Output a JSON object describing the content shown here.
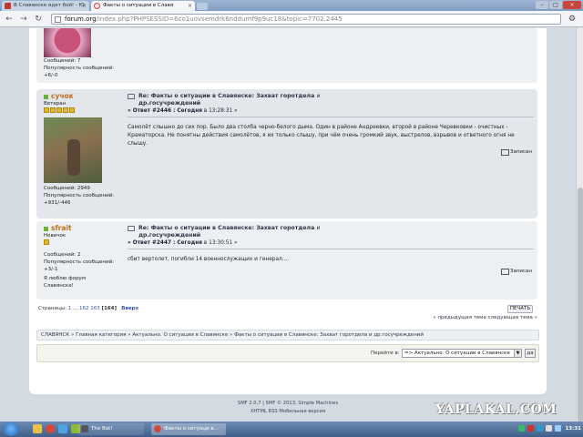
{
  "browser": {
    "tabs": [
      {
        "label": "В Славянске идет бой! - Ю"
      },
      {
        "label": "Факты о ситуации в Славя"
      }
    ],
    "url_host": "forum.org",
    "url_path": "/index.php?PHPSESSID=6co1uovsemdrk6nddumf9p9uc18&topic=7702.2445"
  },
  "posts": [
    {
      "messages": "Сообщений: 7",
      "popularity": "Популярность сообщений:",
      "popularity_value": "+6/-0"
    },
    {
      "name": "сучок",
      "rank": "Ветеран",
      "stars": 5,
      "title": "Re: Факты о ситуации в Славянске: Захват горотдела",
      "title_rest": "и",
      "title_line2": "др.госучреждений",
      "meta_reply": "« Ответ #2446 : Сегодня",
      "meta_at": "в",
      "meta_time": "13:28:31 »",
      "text": "Самолёт слышно до сих пор. Было два столба черно-белого дыма. Один в районе Андреевки, второй в районе Черевковки - очистных - Краматорска. Не понятны действия самолётов, я их только слышу, при чём очень громкий звук, выстрелов, взрывов и ответного огня не слышу.",
      "quote": "Записан",
      "messages": "Сообщений: 2949",
      "popularity": "Популярность сообщений:",
      "popularity_value": "+931/-446"
    },
    {
      "name": "sfrait",
      "rank": "Новичок",
      "stars": 1,
      "title": "Re: Факты о ситуации в Славянске: Захват горотдела",
      "title_rest": "и",
      "title_line2": "др.госучреждений",
      "meta_reply": "« Ответ #2447 : Сегодня",
      "meta_at": "в",
      "meta_time": "13:30:51 »",
      "text": "сбит вертолет, погибли 14 военнослужащих и генерал....",
      "quote": "Записан",
      "messages": "Сообщений: 2",
      "popularity": "Популярность сообщений:",
      "popularity_value": "+3/-1",
      "signature": "Я люблю форум Славянска!"
    }
  ],
  "pagination": {
    "label": "Страницы:",
    "first": "1",
    "dots": "...",
    "p162": "162",
    "p163": "163",
    "current": "[164]",
    "up": "Вверх"
  },
  "print_button": "ПЕЧАТЬ",
  "prevnext": "« предыдущая тема следующая тема »",
  "breadcrumb": "СЛАВЯНСК » Главная категория » Актуально. О ситуации в Славянске » Факты о ситуации в Славянске: Захват горотдела и др.госучреждений",
  "jump": {
    "label": "Перейти в:",
    "selected": "=> Актуально. О ситуации в Славянске",
    "go": "да"
  },
  "footer": {
    "line1": "SMF 2.0.7 | SMF © 2013, Simple Machines",
    "line2": "XHTML   RSS   Мобильная версия"
  },
  "watermark": "YAPLAKAL.COM",
  "taskbar": {
    "task1": "The Bat!",
    "task2": "Факты о ситуаци в...",
    "clock": "13:31"
  },
  "colors": {
    "accent_name": "#c06c1c",
    "online_dot": "#6ab03a",
    "link": "#3355aa"
  }
}
